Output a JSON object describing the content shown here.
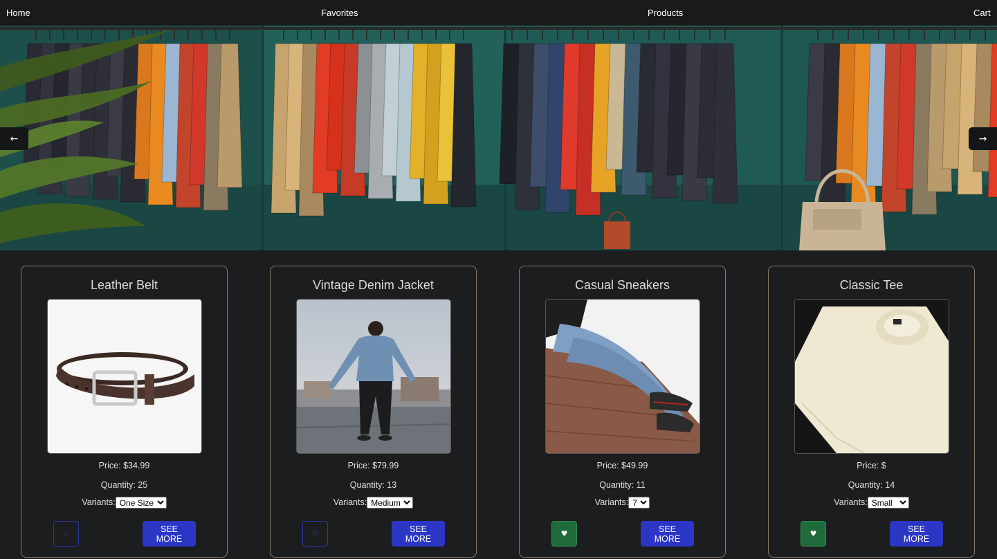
{
  "nav": {
    "home": "Home",
    "favorites": "Favorites",
    "products": "Products",
    "cart": "Cart"
  },
  "carousel": {
    "prev_icon": "arrow-left-icon",
    "next_icon": "arrow-right-icon"
  },
  "products": [
    {
      "name": "Leather Belt",
      "price": "Price: $34.99",
      "quantity": "Quantity: 25",
      "variants_label": "Variants:",
      "variant_selected": "One Size",
      "favorited": false,
      "see_more": "SEE MORE"
    },
    {
      "name": "Vintage Denim Jacket",
      "price": "Price: $79.99",
      "quantity": "Quantity: 13",
      "variants_label": "Variants:",
      "variant_selected": "Medium",
      "favorited": false,
      "see_more": "SEE MORE"
    },
    {
      "name": "Casual Sneakers",
      "price": "Price: $49.99",
      "quantity": "Quantity: 11",
      "variants_label": "Variants:",
      "variant_selected": "7",
      "favorited": true,
      "see_more": "SEE MORE"
    },
    {
      "name": "Classic Tee",
      "price": "Price: $",
      "quantity": "Quantity: 14",
      "variants_label": "Variants:",
      "variant_selected": "Small",
      "favorited": true,
      "see_more": "SEE MORE"
    }
  ],
  "colors": {
    "background": "#1c1d1f",
    "navbar": "#1a1a1a",
    "card_border": "#8a7c66",
    "primary_button": "#2c36c4",
    "favorite_active": "#1f6b3b",
    "favorite_inactive_border": "#2c36a8"
  },
  "icons": {
    "favorite_inactive": "heart-outline-icon",
    "favorite_active": "heart-filled-icon"
  }
}
